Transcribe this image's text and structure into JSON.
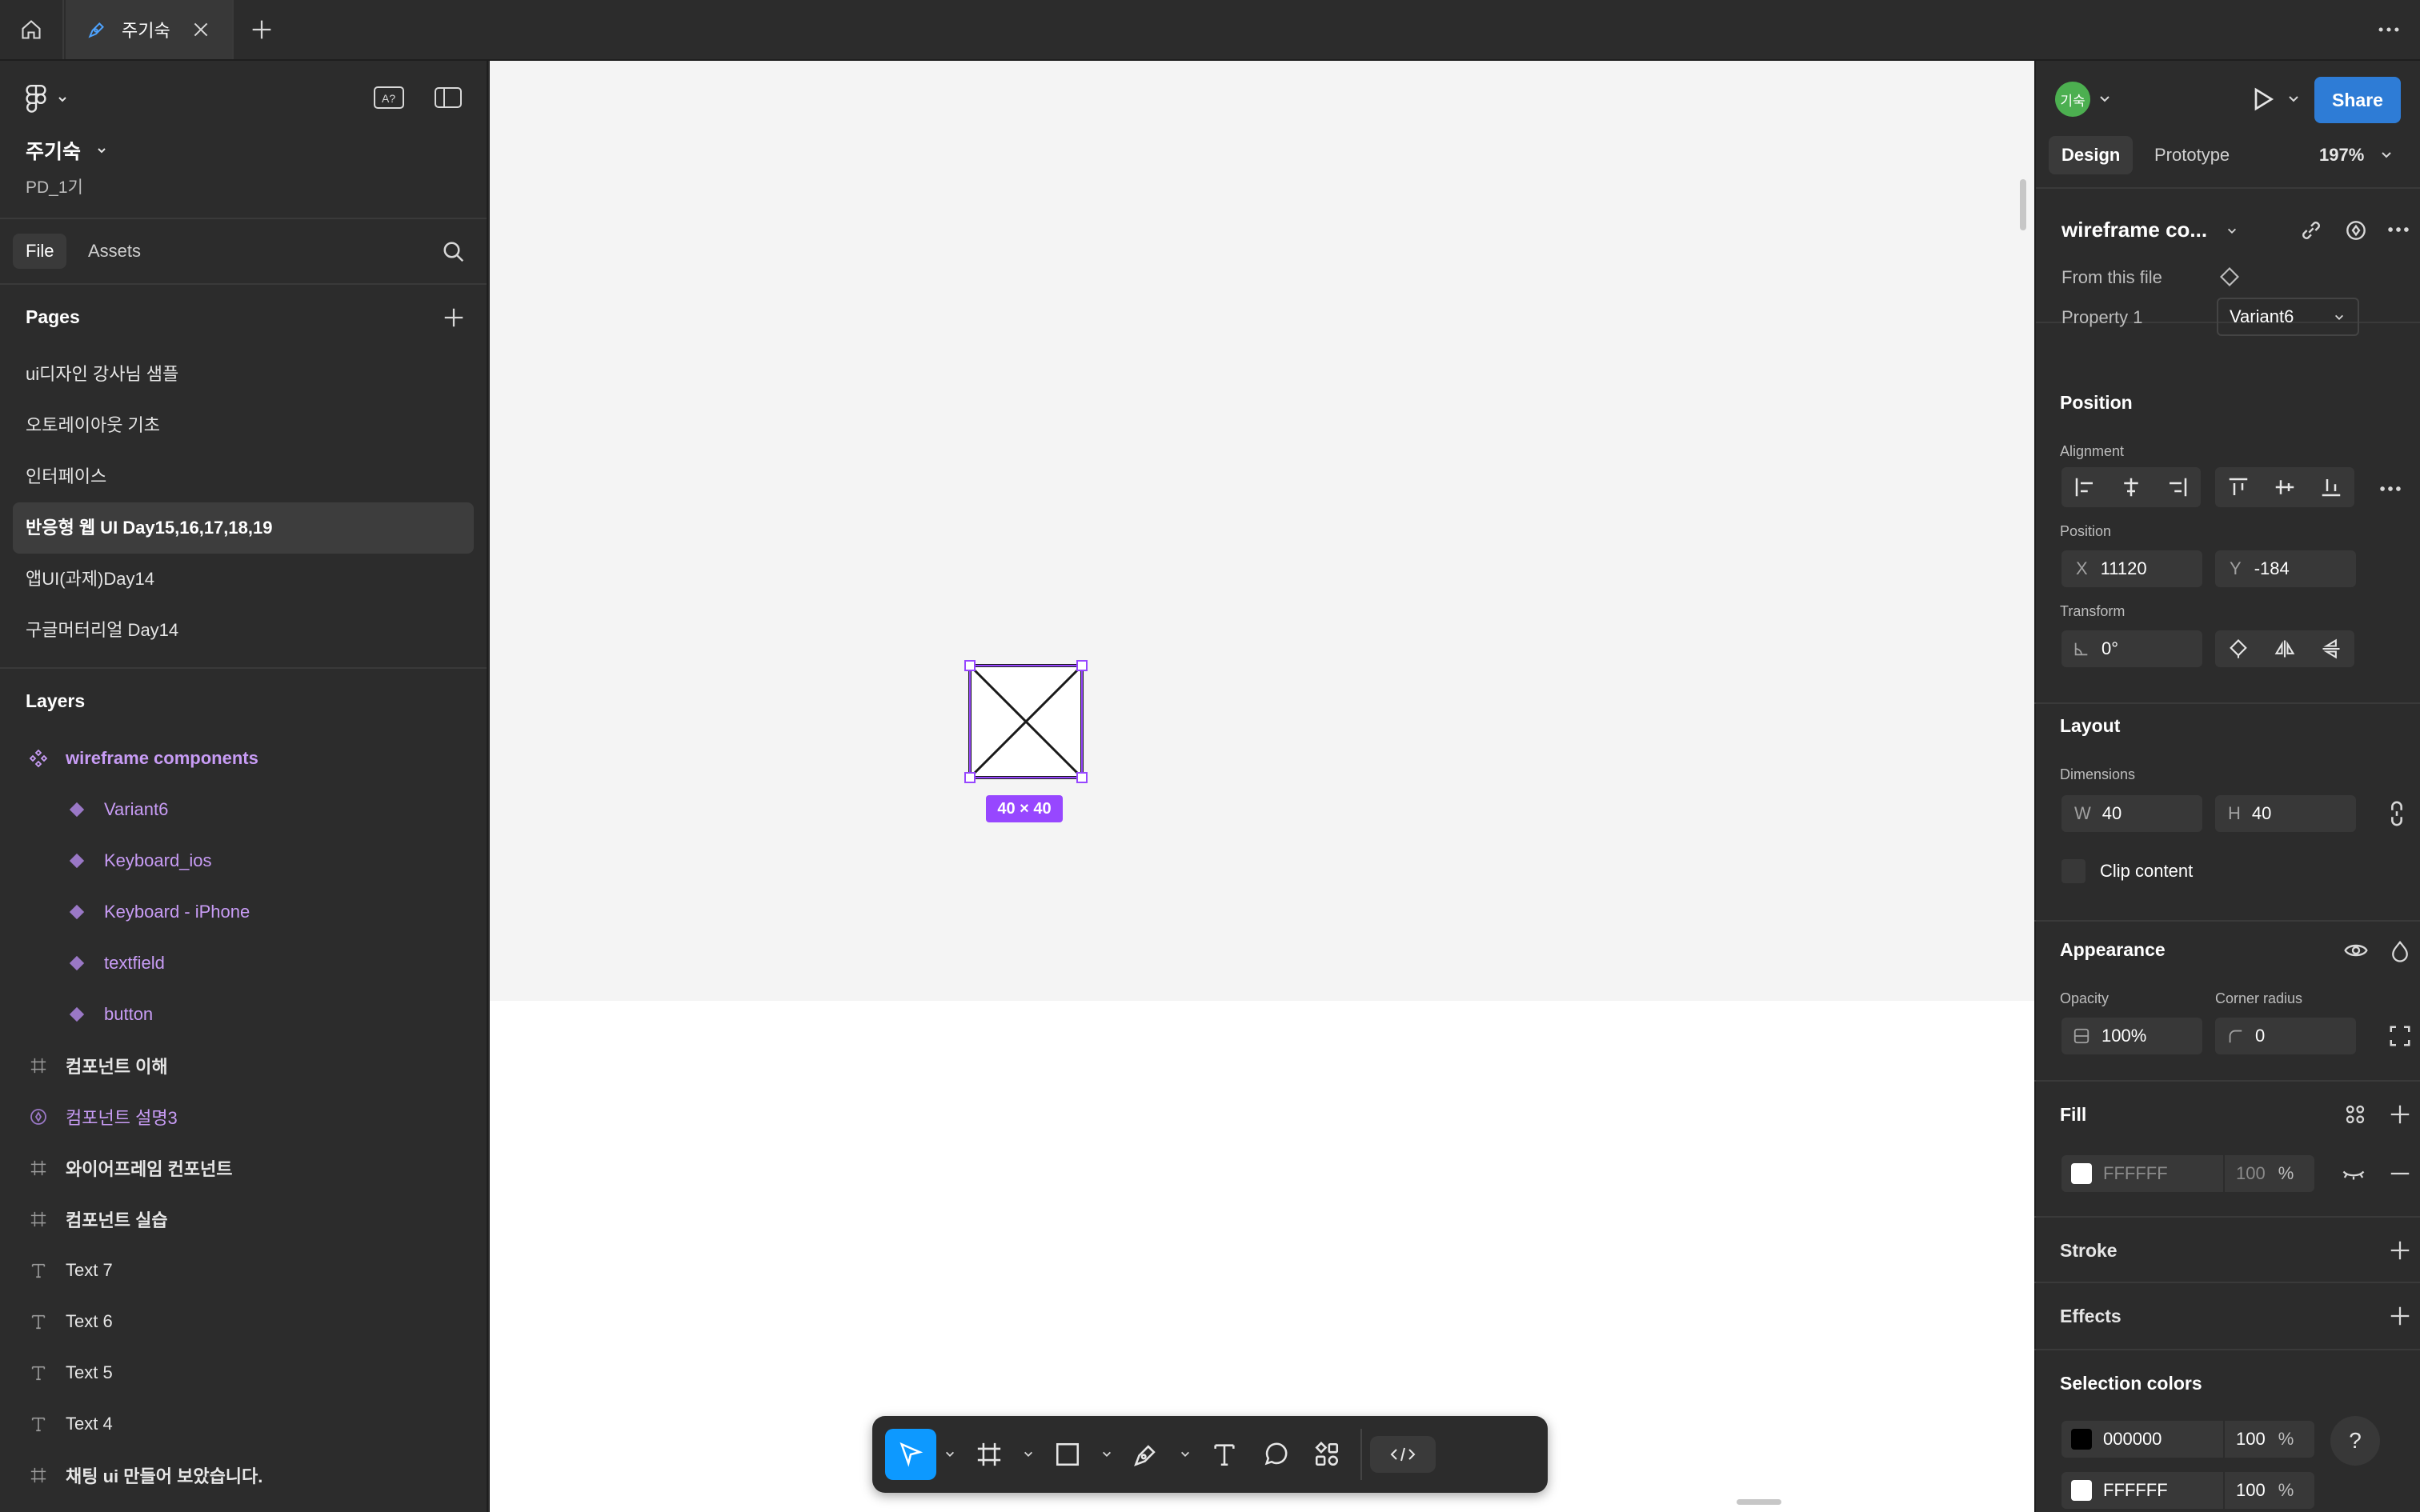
{
  "tabs": {
    "home_icon": "home-icon",
    "current_tab": "주기숙",
    "add_icon": "plus-icon",
    "more_icon": "more-icon"
  },
  "file": {
    "name": "주기숙",
    "project": "PD_1기"
  },
  "left_tabs": {
    "file": "File",
    "assets": "Assets"
  },
  "pages": {
    "title": "Pages",
    "items": [
      {
        "label": "ui디자인 강사님 샘플"
      },
      {
        "label": "오토레이아웃 기초"
      },
      {
        "label": "인터페이스"
      },
      {
        "label": "반응형 웹 UI Day15,16,17,18,19",
        "active": true
      },
      {
        "label": "앱UI(과제)Day14"
      },
      {
        "label": "구글머터리얼 Day14"
      }
    ]
  },
  "layers": {
    "title": "Layers",
    "items": [
      {
        "label": "wireframe components",
        "type": "component-set"
      },
      {
        "label": "Variant6",
        "type": "component"
      },
      {
        "label": "Keyboard_ios",
        "type": "component"
      },
      {
        "label": "Keyboard - iPhone",
        "type": "component"
      },
      {
        "label": "textfield",
        "type": "component"
      },
      {
        "label": "button",
        "type": "component"
      },
      {
        "label": "컴포넌트 이해",
        "type": "frame"
      },
      {
        "label": "컴포넌트 설명3",
        "type": "component-set"
      },
      {
        "label": "와이어프레임 컨포넌트",
        "type": "frame"
      },
      {
        "label": "컴포넌트 실습",
        "type": "frame"
      },
      {
        "label": "Text 7",
        "type": "text"
      },
      {
        "label": "Text 6",
        "type": "text"
      },
      {
        "label": "Text 5",
        "type": "text"
      },
      {
        "label": "Text 4",
        "type": "text"
      },
      {
        "label": "채팅 ui 만들어 보았습니다.",
        "type": "frame"
      }
    ]
  },
  "canvas": {
    "selection_size": "40 × 40"
  },
  "header": {
    "avatar": "기숙",
    "share": "Share",
    "design_tab": "Design",
    "prototype_tab": "Prototype",
    "zoom": "197%"
  },
  "component": {
    "name": "wireframe co...",
    "from_file": "From this file",
    "property_label": "Property 1",
    "property_value": "Variant6"
  },
  "position": {
    "title": "Position",
    "alignment_label": "Alignment",
    "position_label": "Position",
    "x_label": "X",
    "x": "11120",
    "y_label": "Y",
    "y": "-184",
    "transform_label": "Transform",
    "rotation": "0°"
  },
  "layout": {
    "title": "Layout",
    "dimensions_label": "Dimensions",
    "w_label": "W",
    "w": "40",
    "h_label": "H",
    "h": "40",
    "clip_label": "Clip content"
  },
  "appearance": {
    "title": "Appearance",
    "opacity_label": "Opacity",
    "opacity": "100%",
    "radius_label": "Corner radius",
    "radius": "0"
  },
  "fill": {
    "title": "Fill",
    "hex": "FFFFFF",
    "opacity": "100",
    "unit": "%",
    "color": "#ffffff"
  },
  "stroke": {
    "title": "Stroke"
  },
  "effects": {
    "title": "Effects"
  },
  "selection_colors": {
    "title": "Selection colors",
    "items": [
      {
        "hex": "000000",
        "opacity": "100",
        "unit": "%",
        "color": "#000000"
      },
      {
        "hex": "FFFFFF",
        "opacity": "100",
        "unit": "%",
        "color": "#ffffff"
      }
    ]
  },
  "help": "?",
  "colors": {
    "accent": "#0d99ff",
    "share_button": "#2e7cd6",
    "component_purple": "#c89cf5",
    "selection_purple": "#9747ff"
  }
}
